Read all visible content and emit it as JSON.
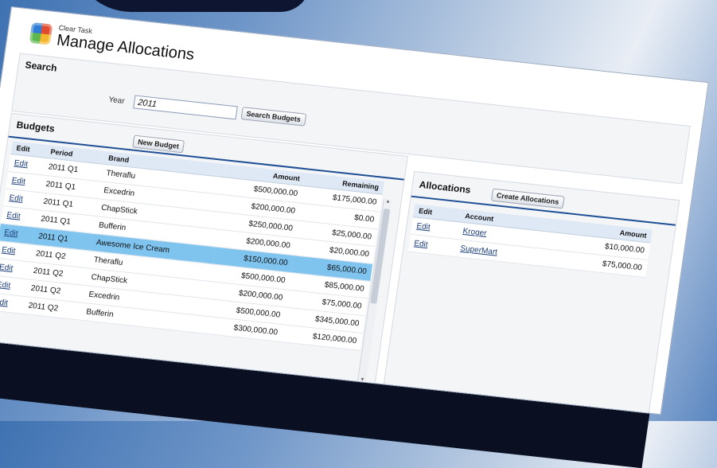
{
  "app": {
    "brand": "Clear Task",
    "title": "Manage Allocations"
  },
  "search": {
    "section_title": "Search",
    "year_label": "Year",
    "year_value": "2011",
    "button_label": "Search Budgets"
  },
  "budgets": {
    "section_title": "Budgets",
    "new_button_label": "New Budget",
    "columns": {
      "edit": "Edit",
      "period": "Period",
      "brand": "Brand",
      "amount": "Amount",
      "remaining": "Remaining"
    },
    "rows": [
      {
        "edit": "Edit",
        "period": "2011 Q1",
        "brand": "Theraflu",
        "amount": "$500,000.00",
        "remaining": "$175,000.00"
      },
      {
        "edit": "Edit",
        "period": "2011 Q1",
        "brand": "Excedrin",
        "amount": "$200,000.00",
        "remaining": "$0.00"
      },
      {
        "edit": "Edit",
        "period": "2011 Q1",
        "brand": "ChapStick",
        "amount": "$250,000.00",
        "remaining": "$25,000.00"
      },
      {
        "edit": "Edit",
        "period": "2011 Q1",
        "brand": "Bufferin",
        "amount": "$200,000.00",
        "remaining": "$20,000.00"
      },
      {
        "edit": "Edit",
        "period": "2011 Q1",
        "brand": "Awesome Ice Cream",
        "amount": "$150,000.00",
        "remaining": "$65,000.00"
      },
      {
        "edit": "Edit",
        "period": "2011 Q2",
        "brand": "Theraflu",
        "amount": "$500,000.00",
        "remaining": "$85,000.00"
      },
      {
        "edit": "Edit",
        "period": "2011 Q2",
        "brand": "ChapStick",
        "amount": "$200,000.00",
        "remaining": "$75,000.00"
      },
      {
        "edit": "Edit",
        "period": "2011 Q2",
        "brand": "Excedrin",
        "amount": "$500,000.00",
        "remaining": "$345,000.00"
      },
      {
        "edit": "Edit",
        "period": "2011 Q2",
        "brand": "Bufferin",
        "amount": "$300,000.00",
        "remaining": "$120,000.00"
      }
    ],
    "selected_row": 4
  },
  "allocations": {
    "section_title": "Allocations",
    "create_button_label": "Create Allocations",
    "columns": {
      "edit": "Edit",
      "account": "Account",
      "amount": "Amount"
    },
    "rows": [
      {
        "edit": "Edit",
        "account": "Kroger",
        "amount": "$10,000.00"
      },
      {
        "edit": "Edit",
        "account": "SuperMart",
        "amount": "$75,000.00"
      }
    ]
  },
  "colors": {
    "selected_row": "#7ec4ef",
    "accent": "#1f4f95",
    "link": "#1b3e7a"
  }
}
